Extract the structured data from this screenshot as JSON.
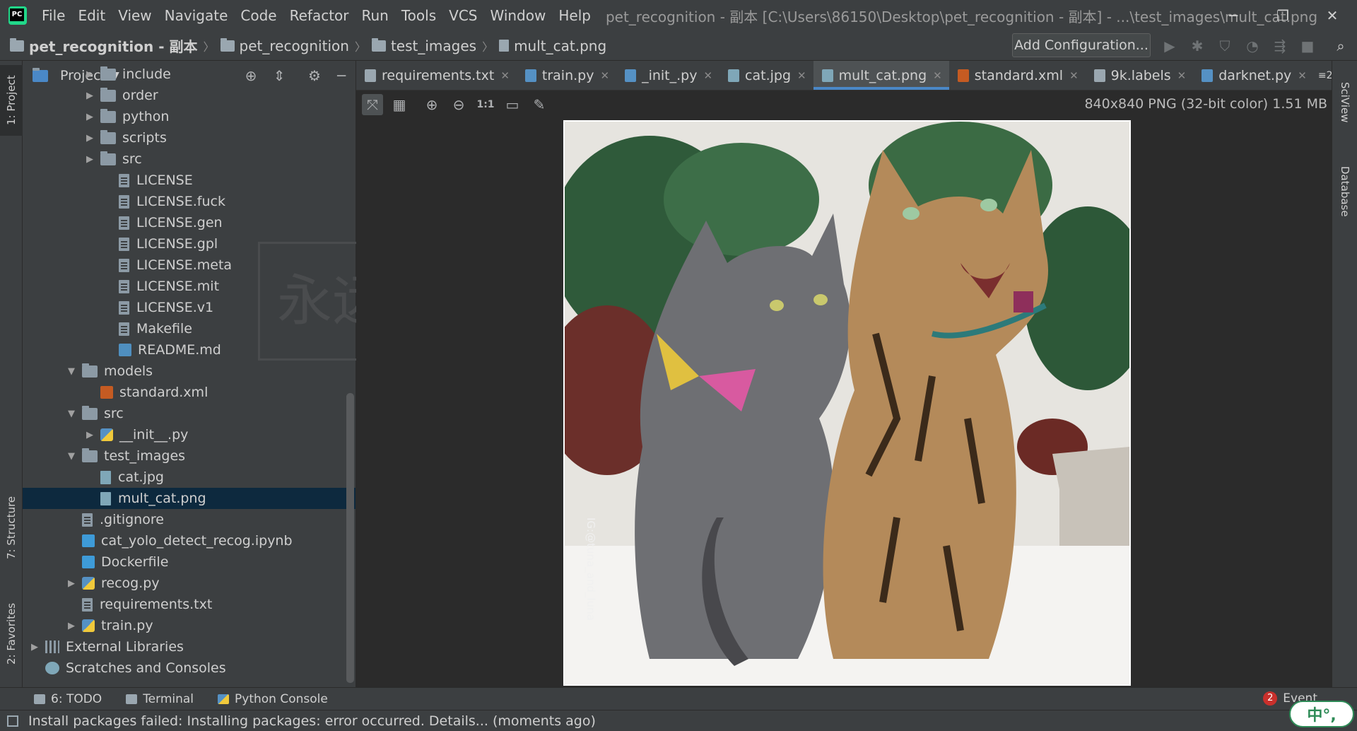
{
  "menubar": {
    "items": [
      "File",
      "Edit",
      "View",
      "Navigate",
      "Code",
      "Refactor",
      "Run",
      "Tools",
      "VCS",
      "Window",
      "Help"
    ],
    "window_title": "pet_recognition - 副本 [C:\\Users\\86150\\Desktop\\pet_recognition - 副本] - ...\\test_images\\mult_cat.png"
  },
  "navbar": {
    "breadcrumbs": [
      "pet_recognition - 副本",
      "pet_recognition",
      "test_images",
      "mult_cat.png"
    ],
    "add_config_label": "Add Configuration..."
  },
  "left_strip": {
    "project_tab": "1: Project",
    "structure_tab": "7: Structure",
    "favorites_tab": "2: Favorites"
  },
  "project_panel": {
    "title": "Project",
    "tree": [
      {
        "label": "include",
        "indent": 3,
        "type": "folder",
        "arrow": "collapsed"
      },
      {
        "label": "order",
        "indent": 3,
        "type": "folder",
        "arrow": "collapsed"
      },
      {
        "label": "python",
        "indent": 3,
        "type": "folder",
        "arrow": "collapsed"
      },
      {
        "label": "scripts",
        "indent": 3,
        "type": "folder",
        "arrow": "collapsed"
      },
      {
        "label": "src",
        "indent": 3,
        "type": "folder",
        "arrow": "collapsed"
      },
      {
        "label": "LICENSE",
        "indent": 4,
        "type": "file",
        "arrow": ""
      },
      {
        "label": "LICENSE.fuck",
        "indent": 4,
        "type": "file",
        "arrow": ""
      },
      {
        "label": "LICENSE.gen",
        "indent": 4,
        "type": "file",
        "arrow": ""
      },
      {
        "label": "LICENSE.gpl",
        "indent": 4,
        "type": "file",
        "arrow": ""
      },
      {
        "label": "LICENSE.meta",
        "indent": 4,
        "type": "file",
        "arrow": ""
      },
      {
        "label": "LICENSE.mit",
        "indent": 4,
        "type": "file",
        "arrow": ""
      },
      {
        "label": "LICENSE.v1",
        "indent": 4,
        "type": "file",
        "arrow": ""
      },
      {
        "label": "Makefile",
        "indent": 4,
        "type": "file",
        "arrow": ""
      },
      {
        "label": "README.md",
        "indent": 4,
        "type": "md",
        "arrow": ""
      },
      {
        "label": "models",
        "indent": 2,
        "type": "folder",
        "arrow": "expanded"
      },
      {
        "label": "standard.xml",
        "indent": 3,
        "type": "xml",
        "arrow": ""
      },
      {
        "label": "src",
        "indent": 2,
        "type": "folder",
        "arrow": "expanded"
      },
      {
        "label": "__init__.py",
        "indent": 3,
        "type": "py",
        "arrow": "collapsed"
      },
      {
        "label": "test_images",
        "indent": 2,
        "type": "folder",
        "arrow": "expanded"
      },
      {
        "label": "cat.jpg",
        "indent": 3,
        "type": "img",
        "arrow": ""
      },
      {
        "label": "mult_cat.png",
        "indent": 3,
        "type": "img",
        "arrow": "",
        "selected": true
      },
      {
        "label": ".gitignore",
        "indent": 2,
        "type": "file",
        "arrow": ""
      },
      {
        "label": "cat_yolo_detect_recog.ipynb",
        "indent": 2,
        "type": "nb",
        "arrow": ""
      },
      {
        "label": "Dockerfile",
        "indent": 2,
        "type": "docker",
        "arrow": ""
      },
      {
        "label": "recog.py",
        "indent": 2,
        "type": "py",
        "arrow": "collapsed"
      },
      {
        "label": "requirements.txt",
        "indent": 2,
        "type": "file",
        "arrow": ""
      },
      {
        "label": "train.py",
        "indent": 2,
        "type": "py",
        "arrow": "collapsed"
      },
      {
        "label": "External Libraries",
        "indent": 0,
        "type": "lib",
        "arrow": "collapsed"
      },
      {
        "label": "Scratches and Consoles",
        "indent": 0,
        "type": "scratch",
        "arrow": ""
      }
    ]
  },
  "watermark_text": "永远相信美",
  "editor": {
    "tabs": [
      {
        "label": "requirements.txt",
        "icon": "text-file-icon",
        "color": "#9aa7b0"
      },
      {
        "label": "train.py",
        "icon": "python-file-icon",
        "color": "#5591c4"
      },
      {
        "label": "_init_.py",
        "icon": "python-file-icon",
        "color": "#5591c4"
      },
      {
        "label": "cat.jpg",
        "icon": "image-file-icon",
        "color": "#7fa7b8"
      },
      {
        "label": "mult_cat.png",
        "icon": "image-file-icon",
        "color": "#7fa7b8",
        "active": true
      },
      {
        "label": "standard.xml",
        "icon": "xml-file-icon",
        "color": "#c55b22"
      },
      {
        "label": "9k.labels",
        "icon": "text-file-icon",
        "color": "#9aa7b0"
      },
      {
        "label": "darknet.py",
        "icon": "python-file-icon",
        "color": "#5591c4"
      }
    ],
    "tab_overflow": "≡2",
    "image_info": "840x840 PNG (32-bit color) 1.51 MB",
    "image_watermark": "IG:@tuna_and_luna"
  },
  "right_strip": {
    "sciview_tab": "SciView",
    "database_tab": "Database"
  },
  "bottom_tools": {
    "todo_label": "6: TODO",
    "terminal_label": "Terminal",
    "python_console_label": "Python Console",
    "event_count": "2",
    "event_label": "Event"
  },
  "status": {
    "text": "Install packages failed: Installing packages: error occurred. Details... (moments ago)",
    "ime_label": "中°,"
  },
  "colors": {
    "accent": "#4a88c7",
    "selection": "#0d293e",
    "error_badge": "#c9302c"
  }
}
